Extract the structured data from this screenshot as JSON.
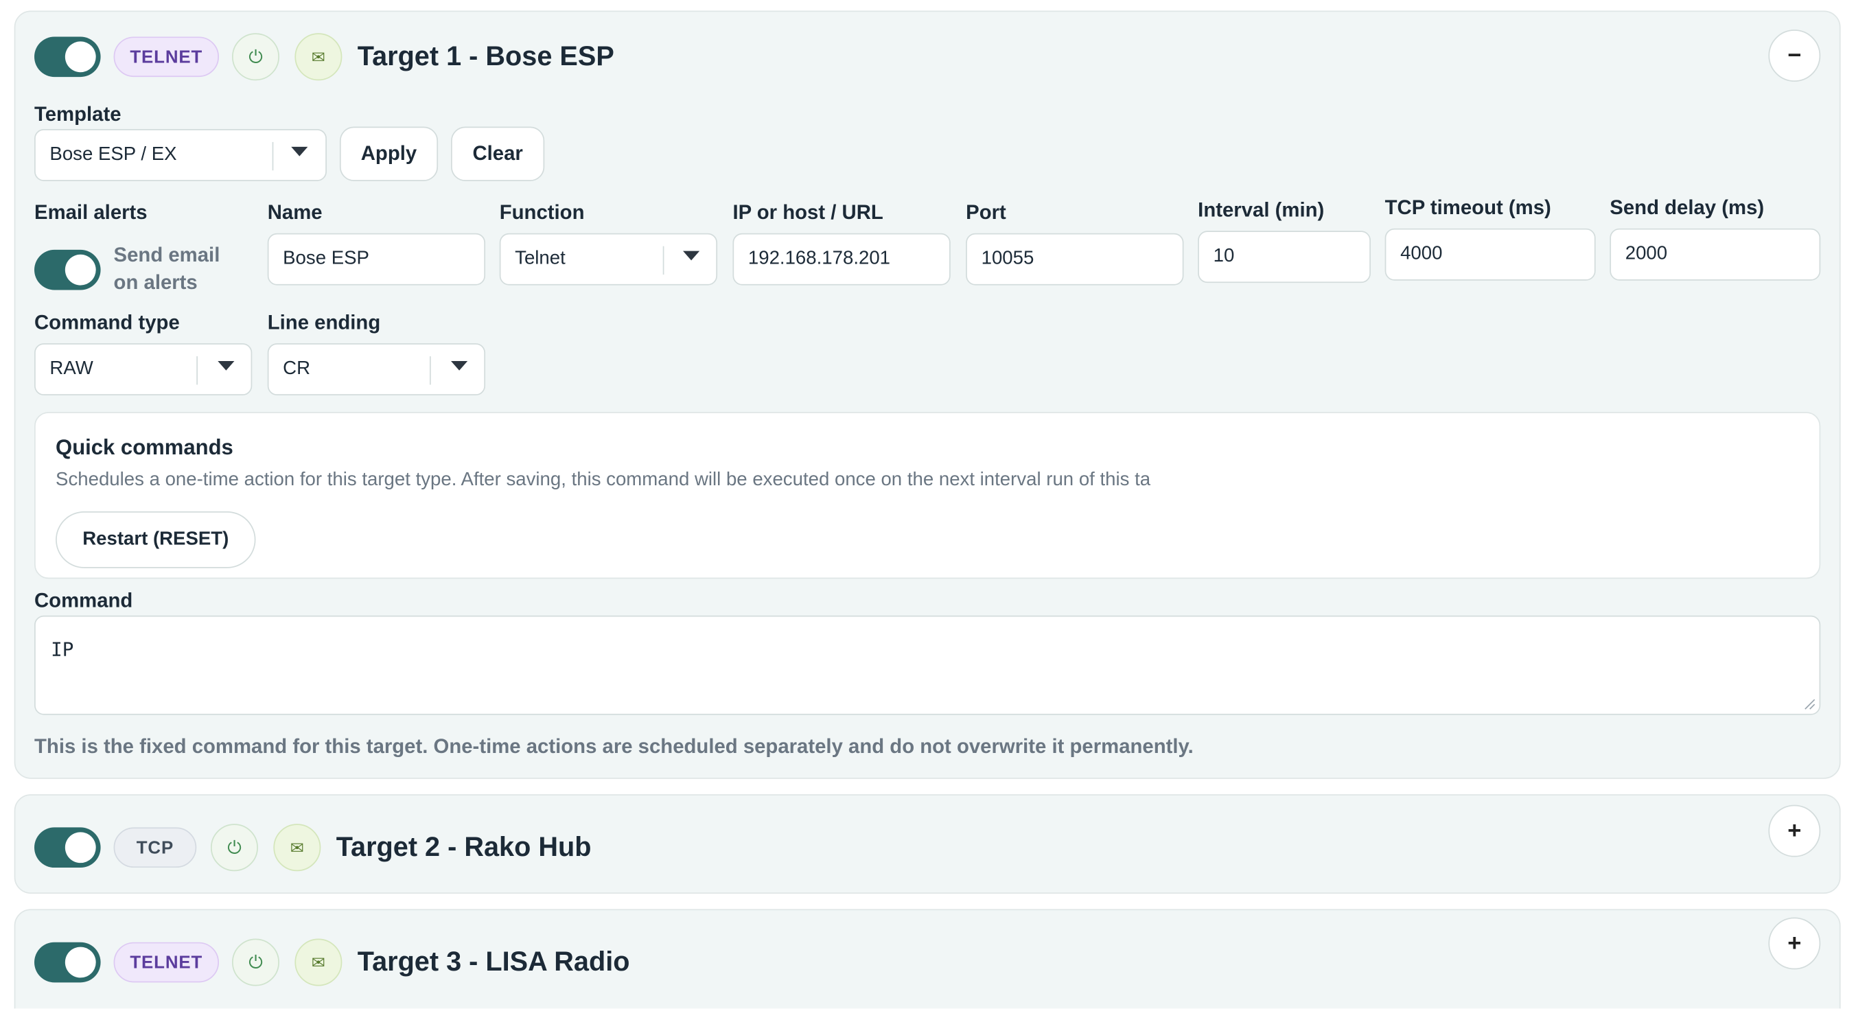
{
  "target1": {
    "protocol": "TELNET",
    "title": "Target 1 - Bose ESP",
    "collapse": "−",
    "template_label": "Template",
    "template_value": "Bose ESP / EX",
    "apply": "Apply",
    "clear": "Clear",
    "email_alerts_label": "Email alerts",
    "send_email_line1": "Send email",
    "send_email_line2": "on alerts",
    "name_label": "Name",
    "name_value": "Bose ESP",
    "function_label": "Function",
    "function_value": "Telnet",
    "ip_label": "IP or host / URL",
    "ip_value": "192.168.178.201",
    "port_label": "Port",
    "port_value": "10055",
    "interval_label": "Interval (min)",
    "interval_value": "10",
    "tcp_timeout_label": "TCP timeout (ms)",
    "tcp_timeout_value": "4000",
    "send_delay_label": "Send delay (ms)",
    "send_delay_value": "2000",
    "command_type_label": "Command type",
    "command_type_value": "RAW",
    "line_ending_label": "Line ending",
    "line_ending_value": "CR",
    "quick_title": "Quick commands",
    "quick_desc": "Schedules a one-time action for this target type. After saving, this command will be executed once on the next interval run of this ta",
    "restart_button": "Restart (RESET)",
    "command_label": "Command",
    "command_value": "IP",
    "hint": "This is the fixed command for this target. One-time actions are scheduled separately and do not overwrite it permanently."
  },
  "target2": {
    "protocol": "TCP",
    "title": "Target 2 - Rako Hub",
    "expand": "+"
  },
  "target3": {
    "protocol": "TELNET",
    "title": "Target 3 - LISA Radio",
    "expand": "+"
  },
  "icons": {
    "power": "⏻",
    "mail": "✉"
  },
  "colors": {
    "toggle_on": "#2c6a6a",
    "telnet_badge": "#5b3c9d",
    "card_bg": "#f1f6f6"
  }
}
